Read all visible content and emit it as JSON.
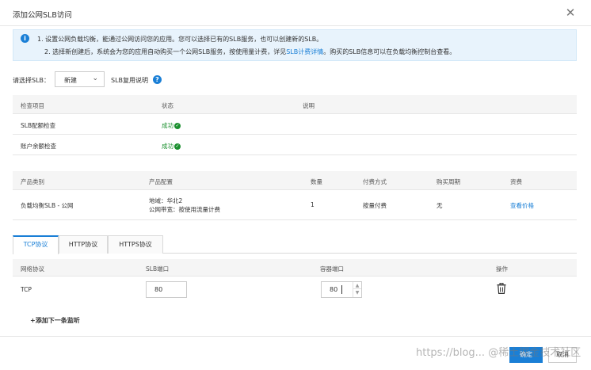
{
  "dialog": {
    "title": "添加公网SLB访问",
    "close_symbol": "✕"
  },
  "notice": {
    "icon_text": "i",
    "line1": "1. 设置公网负载均衡，能通过公网访问您的应用。您可以选择已有的SLB服务，也可以创建新的SLB。",
    "line2_prefix": "2. 选择新创建后，系统会为您的应用自动购买一个公网SLB服务，按使用量计费，详见",
    "line2_link": "SLB计费详情",
    "line2_suffix": "。购买的SLB信息可以在负载均衡控制台查看。"
  },
  "slb_select": {
    "label": "请选择SLB：",
    "value": "新建",
    "help_text": "SLB复用说明",
    "help_icon": "?"
  },
  "check_table": {
    "headers": [
      "检查项目",
      "状态",
      "说明"
    ],
    "rows": [
      {
        "item": "SLB配额检查",
        "status": "成功",
        "note": ""
      },
      {
        "item": "账户余额检查",
        "status": "成功",
        "note": ""
      }
    ]
  },
  "product_table": {
    "headers": [
      "产品类别",
      "产品配置",
      "数量",
      "付费方式",
      "购买周期",
      "资费"
    ],
    "row": {
      "category": "负载均衡SLB - 公网",
      "config_line1": "地域：华北2",
      "config_line2": "公网带宽：按使用流量计费",
      "quantity": "1",
      "payment": "按量付费",
      "period": "无",
      "price_link": "查看价格"
    }
  },
  "tabs": [
    {
      "label": "TCP协议",
      "active": true
    },
    {
      "label": "HTTP协议",
      "active": false
    },
    {
      "label": "HTTPS协议",
      "active": false
    }
  ],
  "listener_table": {
    "headers": [
      "网络协议",
      "SLB端口",
      "容器端口",
      "操作"
    ],
    "row": {
      "protocol": "TCP",
      "slb_port": "80",
      "container_port": "80"
    }
  },
  "add_listener": "+添加下一条监听",
  "footer": {
    "confirm_label": "确定",
    "cancel_label": "取消"
  },
  "watermark": "https://blog... @稀土掘金技术社区",
  "colors": {
    "accent": "#1a7fd6",
    "success": "#1a8f2e",
    "notice_bg": "#e8f3fc"
  }
}
